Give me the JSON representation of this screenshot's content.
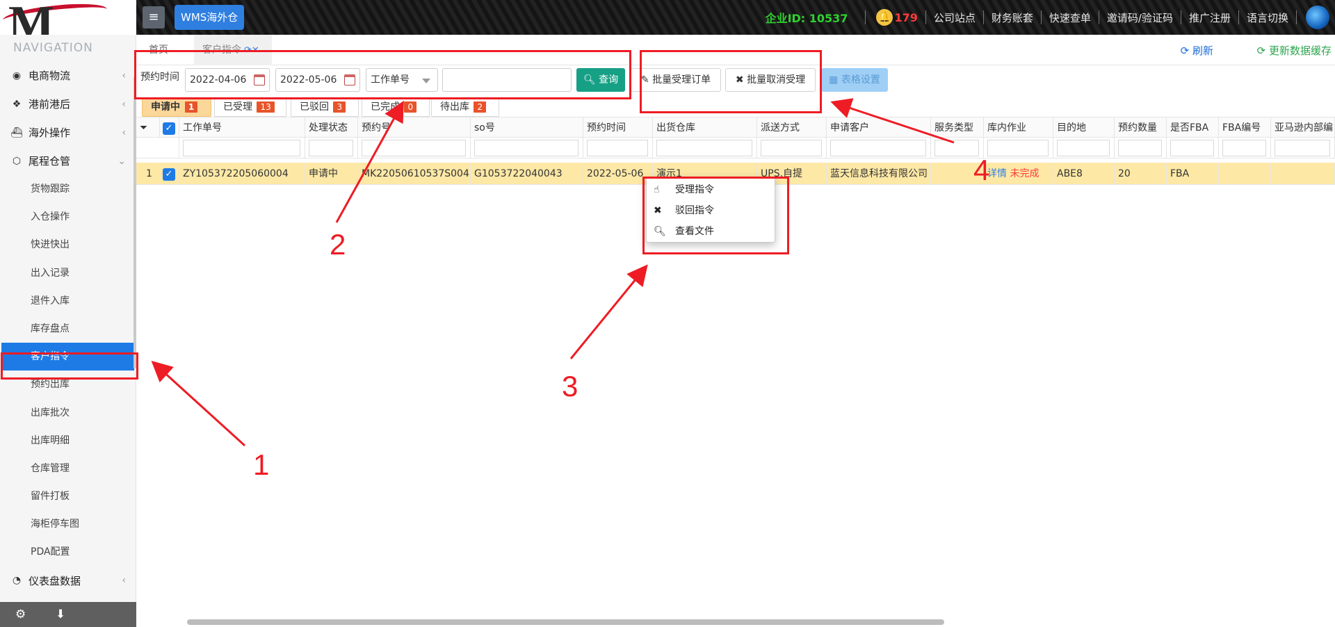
{
  "topbar": {
    "menu_icon": "≡",
    "brand": "WMS海外仓",
    "company_label": "企业ID:",
    "company_id": "10537",
    "notification_count": "179",
    "links": [
      "公司站点",
      "财务账套",
      "快速查单",
      "邀请码/验证码",
      "推广注册",
      "语言切换"
    ]
  },
  "sidebar": {
    "title": "NAVIGATION",
    "groups": [
      {
        "label": "电商物流",
        "icon": "globe-icon"
      },
      {
        "label": "港前港后",
        "icon": "cubes-icon"
      },
      {
        "label": "海外操作",
        "icon": "ship-icon"
      },
      {
        "label": "尾程仓管",
        "icon": "box-icon"
      }
    ],
    "sub_items": [
      "货物跟踪",
      "入仓操作",
      "快进快出",
      "出入记录",
      "退件入库",
      "库存盘点",
      "客户指令",
      "预约出库",
      "出库批次",
      "出库明细",
      "仓库管理",
      "留件打板",
      "海柜停车图",
      "PDA配置"
    ],
    "active_item": "客户指令",
    "dashboard_label": "仪表盘数据",
    "footer_icons": [
      "gear-icon",
      "download-icon"
    ]
  },
  "tabs": {
    "home": "首页",
    "current": "客户指令",
    "refresh": "刷新",
    "refresh_cache": "更新数据缓存"
  },
  "toolbar": {
    "date_label": "预约时间",
    "date_from": "2022-04-06",
    "date_to": "2022-05-06",
    "field_select": "工作单号",
    "search_value": "",
    "query_button": "查询",
    "batch_accept": "批量受理订单",
    "batch_cancel": "批量取消受理",
    "table_settings": "表格设置"
  },
  "status_tabs": [
    {
      "label": "申请中",
      "count": "1",
      "active": true
    },
    {
      "label": "已受理",
      "count": "13"
    },
    {
      "label": "已驳回",
      "count": "3"
    },
    {
      "label": "已完成",
      "count": "0"
    },
    {
      "label": "待出库",
      "count": "2"
    }
  ],
  "table": {
    "headers": [
      "工作单号",
      "处理状态",
      "预约号",
      "so号",
      "预约时间",
      "出货仓库",
      "派送方式",
      "申请客户",
      "服务类型",
      "库内作业",
      "目的地",
      "预约数量",
      "是否FBA",
      "FBA编号",
      "亚马逊内部编"
    ],
    "rows": [
      {
        "index": "1",
        "work_no": "ZY105372205060004",
        "status": "申请中",
        "reservation_no": "MK22050610537S004",
        "so_no": "G1053722040043",
        "reservation_time": "2022-05-06",
        "warehouse": "演示1",
        "delivery": "UPS,自提",
        "customer": "蓝天信息科技有限公司",
        "service_type": "",
        "detail_link": "详情",
        "work_status": "未完成",
        "destination": "ABE8",
        "quantity": "20",
        "is_fba": "FBA",
        "fba_no": "",
        "amazon_no": ""
      }
    ]
  },
  "context_menu": [
    {
      "label": "受理指令",
      "icon": "hand-pointer-icon"
    },
    {
      "label": "驳回指令",
      "icon": "x-icon"
    },
    {
      "label": "查看文件",
      "icon": "magnifier-icon"
    }
  ],
  "annotations": [
    "1",
    "2",
    "3",
    "4"
  ],
  "colors": {
    "accent_blue": "#1e7be6",
    "query_green": "#16a085",
    "annotation_red": "#ee1c24",
    "selected_row": "#fde8a6",
    "count_badge": "#e8542a"
  }
}
